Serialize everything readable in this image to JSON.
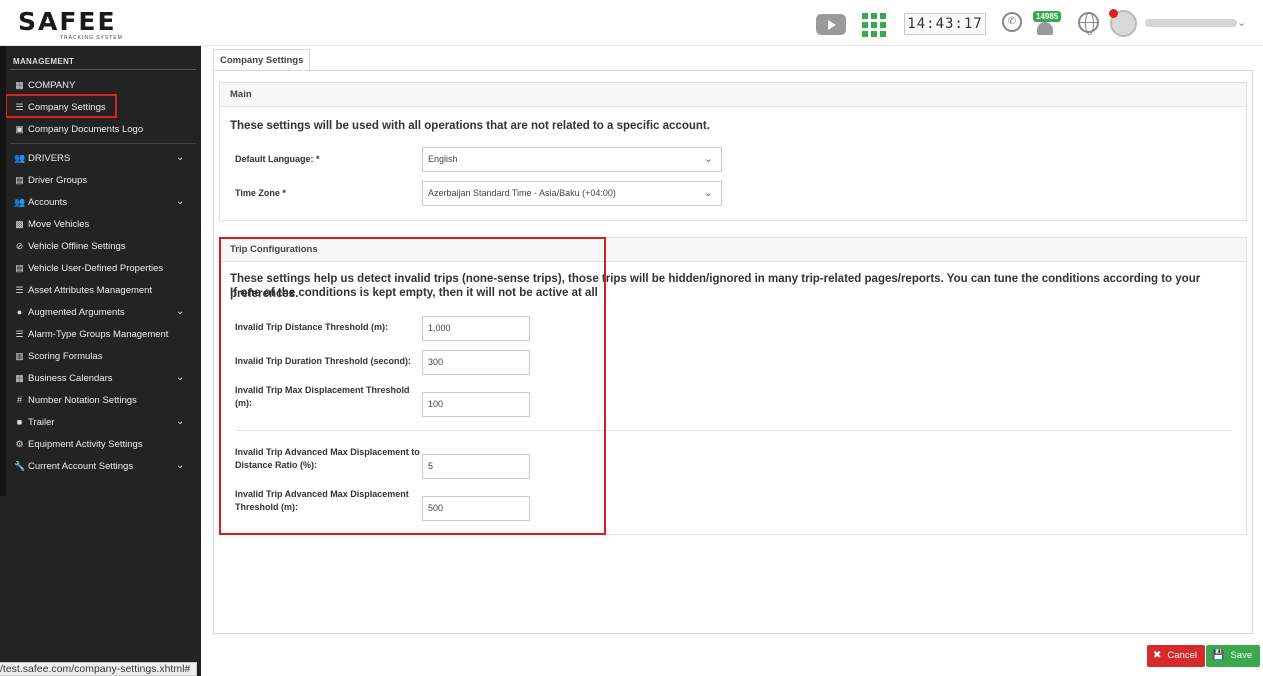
{
  "header": {
    "logo_text": "SAFEE",
    "logo_subtext": "TRACKING SYSTEM",
    "clock": "14:43:17",
    "notification_count": "14985"
  },
  "sidebar": {
    "section_title": "MANAGEMENT",
    "items": [
      {
        "label": "COMPANY",
        "icon": "building-icon"
      },
      {
        "label": "Company Settings",
        "icon": "list-icon"
      },
      {
        "label": "Company Documents Logo",
        "icon": "image-icon"
      },
      {
        "label": "DRIVERS",
        "icon": "users-icon"
      },
      {
        "label": "Driver Groups",
        "icon": "id-card-icon"
      },
      {
        "label": "Accounts",
        "icon": "users-icon"
      },
      {
        "label": "Move Vehicles",
        "icon": "cubes-icon"
      },
      {
        "label": "Vehicle Offline Settings",
        "icon": "eye-slash-icon"
      },
      {
        "label": "Vehicle User-Defined Properties",
        "icon": "table-icon"
      },
      {
        "label": "Asset Attributes Management",
        "icon": "list-icon"
      },
      {
        "label": "Augmented Arguments",
        "icon": "circle-icon"
      },
      {
        "label": "Alarm-Type Groups Management",
        "icon": "list-icon"
      },
      {
        "label": "Scoring Formulas",
        "icon": "calculator-icon"
      },
      {
        "label": "Business Calendars",
        "icon": "calendar-icon"
      },
      {
        "label": "Number Notation Settings",
        "icon": "hashtag-icon"
      },
      {
        "label": "Trailer",
        "icon": "square-icon"
      },
      {
        "label": "Equipment Activity Settings",
        "icon": "cogs-icon"
      },
      {
        "label": "Current Account Settings",
        "icon": "wrench-icon"
      }
    ]
  },
  "main": {
    "tab_label": "Company Settings",
    "main_panel": {
      "title": "Main",
      "description": "These settings will be used with all operations that are not related to a specific account.",
      "language_label": "Default Language:  *",
      "language_value": "English",
      "timezone_label": "Time Zone  *",
      "timezone_value": "Azerbaijan Standard Time - Asia/Baku (+04:00)"
    },
    "trip_panel": {
      "title": "Trip Configurations",
      "description_line1": "These settings help us detect invalid trips (none-sense trips), those trips will be hidden/ignored in many trip-related pages/reports. You can tune the conditions according to your preferences.",
      "description_line2": "If one of the conditions is kept empty, then it will not be active at all",
      "fields": [
        {
          "label": "Invalid Trip Distance Threshold (m):",
          "value": "1,000"
        },
        {
          "label": "Invalid Trip Duration Threshold (second):",
          "value": "300"
        },
        {
          "label_line1": "Invalid Trip Max Displacement Threshold",
          "label_line2": "(m):",
          "value": "100"
        },
        {
          "label_line1": "Invalid Trip Advanced Max Displacement to",
          "label_line2": "Distance Ratio (%):",
          "value": "5"
        },
        {
          "label_line1": "Invalid Trip Advanced Max Displacement",
          "label_line2": "Threshold (m):",
          "value": "500"
        }
      ]
    }
  },
  "footer": {
    "cancel_label": "Cancel",
    "save_label": "Save",
    "status_url": "/test.safee.com/company-settings.xhtml#"
  },
  "colors": {
    "sidebar_bg": "#232323",
    "highlight_red": "#d81e1e",
    "save_green": "#3aa84f",
    "cancel_red": "#d72b2b"
  }
}
